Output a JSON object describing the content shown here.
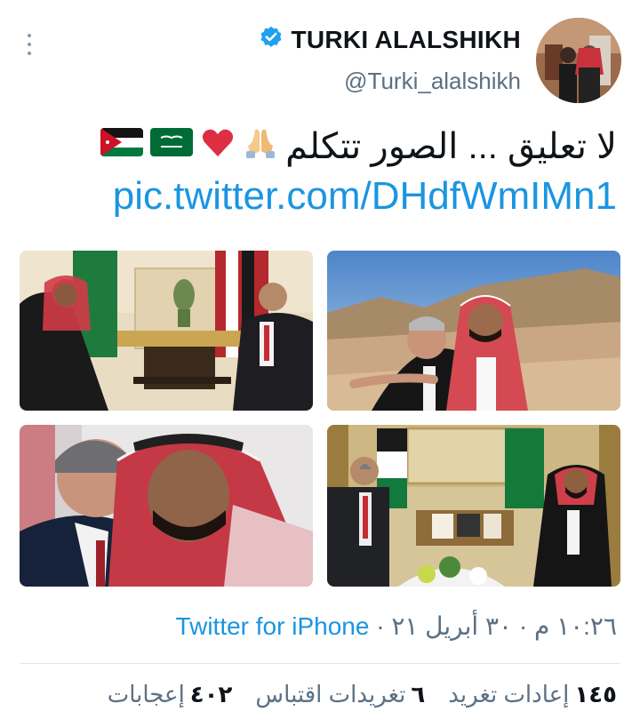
{
  "author": {
    "display_name": "TURKI ALALSHIKH",
    "handle": "@Turki_alalshikh",
    "verified": true
  },
  "tweet": {
    "text": "لا تعليق ... الصور تتكلم",
    "emojis": [
      "folded-hands",
      "red-heart",
      "flag-saudi-arabia",
      "flag-jordan"
    ],
    "link": "pic.twitter.com/DHdfWmIMn1"
  },
  "photos": [
    {
      "id": "photo-1"
    },
    {
      "id": "photo-2"
    },
    {
      "id": "photo-3"
    },
    {
      "id": "photo-4"
    }
  ],
  "meta": {
    "time": "١٠:٢٦ م",
    "date": "٣٠ أبريل ٢١",
    "separator": "·",
    "source": "Twitter for iPhone"
  },
  "stats": {
    "retweets_count": "١٤٥",
    "retweets_label": "إعادات تغريد",
    "quotes_count": "٦",
    "quotes_label": "تغريدات اقتباس",
    "likes_count": "٤٠٢",
    "likes_label": "إعجابات"
  },
  "colors": {
    "link": "#1b95e0",
    "secondary_text": "#5b7083",
    "verified": "#1da1f2"
  }
}
